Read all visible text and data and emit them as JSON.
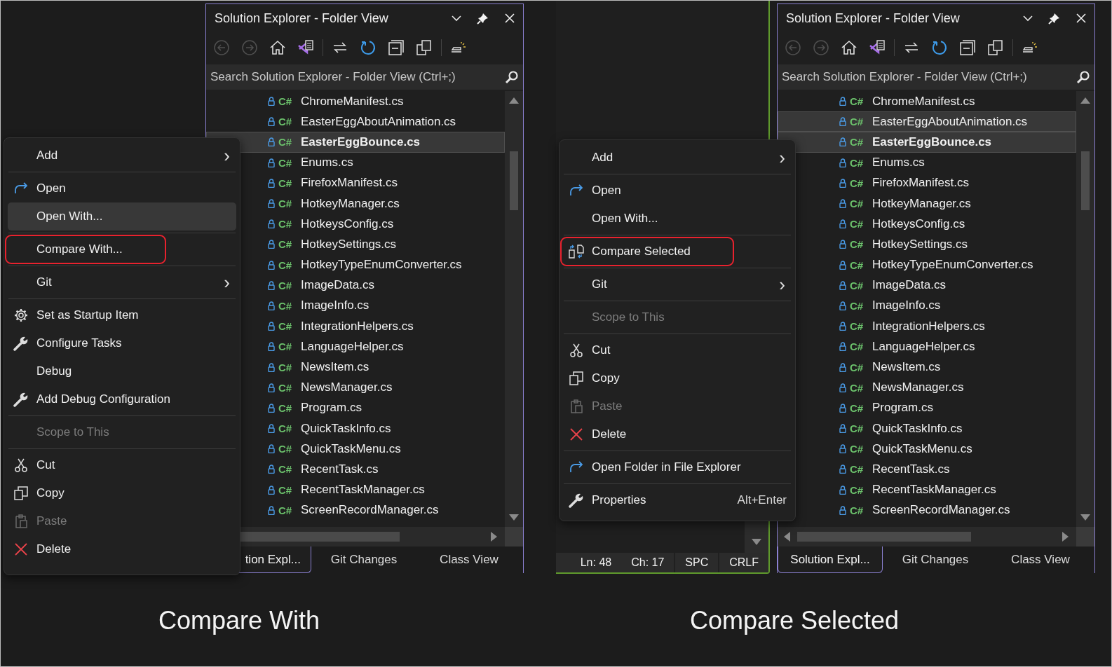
{
  "screens": [
    {
      "caption": "Compare With",
      "solution_explorer": {
        "title": "Solution Explorer - Folder View",
        "search_placeholder": "Search Solution Explorer - Folder View (Ctrl+;)",
        "toolbar": [
          {
            "kind": "back",
            "disabled": true,
            "divider_before": false
          },
          {
            "kind": "forward",
            "disabled": true,
            "divider_before": false
          },
          {
            "kind": "home",
            "disabled": false,
            "divider_before": false
          },
          {
            "kind": "solution",
            "disabled": false,
            "divider_before": false
          },
          {
            "kind": "sync",
            "disabled": false,
            "divider_before": true
          },
          {
            "kind": "refresh",
            "disabled": false,
            "divider_before": false
          },
          {
            "kind": "collapse",
            "disabled": false,
            "divider_before": false
          },
          {
            "kind": "views",
            "disabled": false,
            "divider_before": false
          },
          {
            "kind": "preview",
            "disabled": false,
            "divider_before": true
          }
        ],
        "files": [
          {
            "badge": "C#",
            "name": "ChromeManifest.cs",
            "selected": false,
            "focused": false
          },
          {
            "badge": "C#",
            "name": "EasterEggAboutAnimation.cs",
            "selected": false,
            "focused": false
          },
          {
            "badge": "C#",
            "name": "EasterEggBounce.cs",
            "selected": true,
            "focused": true
          },
          {
            "badge": "C#",
            "name": "Enums.cs",
            "selected": false,
            "focused": false
          },
          {
            "badge": "C#",
            "name": "FirefoxManifest.cs",
            "selected": false,
            "focused": false
          },
          {
            "badge": "C#",
            "name": "HotkeyManager.cs",
            "selected": false,
            "focused": false
          },
          {
            "badge": "C#",
            "name": "HotkeysConfig.cs",
            "selected": false,
            "focused": false
          },
          {
            "badge": "C#",
            "name": "HotkeySettings.cs",
            "selected": false,
            "focused": false
          },
          {
            "badge": "C#",
            "name": "HotkeyTypeEnumConverter.cs",
            "selected": false,
            "focused": false
          },
          {
            "badge": "C#",
            "name": "ImageData.cs",
            "selected": false,
            "focused": false
          },
          {
            "badge": "C#",
            "name": "ImageInfo.cs",
            "selected": false,
            "focused": false
          },
          {
            "badge": "C#",
            "name": "IntegrationHelpers.cs",
            "selected": false,
            "focused": false
          },
          {
            "badge": "C#",
            "name": "LanguageHelper.cs",
            "selected": false,
            "focused": false
          },
          {
            "badge": "C#",
            "name": "NewsItem.cs",
            "selected": false,
            "focused": false
          },
          {
            "badge": "C#",
            "name": "NewsManager.cs",
            "selected": false,
            "focused": false
          },
          {
            "badge": "C#",
            "name": "Program.cs",
            "selected": false,
            "focused": false
          },
          {
            "badge": "C#",
            "name": "QuickTaskInfo.cs",
            "selected": false,
            "focused": false
          },
          {
            "badge": "C#",
            "name": "QuickTaskMenu.cs",
            "selected": false,
            "focused": false
          },
          {
            "badge": "C#",
            "name": "RecentTask.cs",
            "selected": false,
            "focused": false
          },
          {
            "badge": "C#",
            "name": "RecentTaskManager.cs",
            "selected": false,
            "focused": false
          },
          {
            "badge": "C#",
            "name": "ScreenRecordManager.cs",
            "selected": false,
            "focused": false
          }
        ],
        "tabs": [
          {
            "label": "tion Expl...",
            "selected": true
          },
          {
            "label": "Git Changes",
            "selected": false
          },
          {
            "label": "Class View",
            "selected": false
          }
        ]
      },
      "context_menu": {
        "items": [
          {
            "label": "Add",
            "kind": "plain",
            "arrow": "›",
            "disabled": false,
            "hovered": false,
            "outlined": false,
            "divider_before": false
          },
          {
            "label": "Open",
            "kind": "open",
            "disabled": false,
            "hovered": false,
            "outlined": false,
            "divider_before": true
          },
          {
            "label": "Open With...",
            "kind": "plain",
            "disabled": false,
            "hovered": true,
            "outlined": false,
            "divider_before": false
          },
          {
            "label": "Compare With...",
            "kind": "plain",
            "disabled": false,
            "hovered": false,
            "outlined": true,
            "divider_before": true
          },
          {
            "label": "Git",
            "kind": "plain",
            "arrow": "›",
            "disabled": false,
            "hovered": false,
            "outlined": false,
            "divider_before": true
          },
          {
            "label": "Set as Startup Item",
            "kind": "settings",
            "disabled": false,
            "hovered": false,
            "outlined": false,
            "divider_before": true
          },
          {
            "label": "Configure Tasks",
            "kind": "tool",
            "disabled": false,
            "hovered": false,
            "outlined": false,
            "divider_before": false
          },
          {
            "label": "Debug",
            "kind": "plain",
            "disabled": false,
            "hovered": false,
            "outlined": false,
            "divider_before": false
          },
          {
            "label": "Add Debug Configuration",
            "kind": "tool",
            "disabled": false,
            "hovered": false,
            "outlined": false,
            "divider_before": false
          },
          {
            "label": "Scope to This",
            "kind": "plain",
            "disabled": true,
            "hovered": false,
            "outlined": false,
            "divider_before": true
          },
          {
            "label": "Cut",
            "kind": "cut",
            "disabled": false,
            "hovered": false,
            "outlined": false,
            "divider_before": true
          },
          {
            "label": "Copy",
            "kind": "copy",
            "disabled": false,
            "hovered": false,
            "outlined": false,
            "divider_before": false
          },
          {
            "label": "Paste",
            "kind": "paste",
            "disabled": true,
            "hovered": false,
            "outlined": false,
            "divider_before": false
          },
          {
            "label": "Delete",
            "kind": "delete",
            "disabled": false,
            "hovered": false,
            "outlined": false,
            "divider_before": false
          }
        ]
      }
    },
    {
      "caption": "Compare Selected",
      "status_bar": {
        "line": "Ln: 48",
        "column": "Ch: 17",
        "indent": "SPC",
        "line_ending": "CRLF"
      },
      "solution_explorer": {
        "title": "Solution Explorer - Folder View",
        "search_placeholder": "Search Solution Explorer - Folder View (Ctrl+;)",
        "toolbar": [
          {
            "kind": "back",
            "disabled": true,
            "divider_before": false
          },
          {
            "kind": "forward",
            "disabled": true,
            "divider_before": false
          },
          {
            "kind": "home",
            "disabled": false,
            "divider_before": false
          },
          {
            "kind": "solution",
            "disabled": false,
            "divider_before": false
          },
          {
            "kind": "sync",
            "disabled": false,
            "divider_before": true
          },
          {
            "kind": "refresh",
            "disabled": false,
            "divider_before": false
          },
          {
            "kind": "collapse",
            "disabled": false,
            "divider_before": false
          },
          {
            "kind": "views",
            "disabled": false,
            "divider_before": false
          },
          {
            "kind": "preview",
            "disabled": false,
            "divider_before": true
          }
        ],
        "files": [
          {
            "badge": "C#",
            "name": "ChromeManifest.cs",
            "selected": false,
            "focused": false
          },
          {
            "badge": "C#",
            "name": "EasterEggAboutAnimation.cs",
            "selected": true,
            "focused": false
          },
          {
            "badge": "C#",
            "name": "EasterEggBounce.cs",
            "selected": true,
            "focused": true
          },
          {
            "badge": "C#",
            "name": "Enums.cs",
            "selected": false,
            "focused": false
          },
          {
            "badge": "C#",
            "name": "FirefoxManifest.cs",
            "selected": false,
            "focused": false
          },
          {
            "badge": "C#",
            "name": "HotkeyManager.cs",
            "selected": false,
            "focused": false
          },
          {
            "badge": "C#",
            "name": "HotkeysConfig.cs",
            "selected": false,
            "focused": false
          },
          {
            "badge": "C#",
            "name": "HotkeySettings.cs",
            "selected": false,
            "focused": false
          },
          {
            "badge": "C#",
            "name": "HotkeyTypeEnumConverter.cs",
            "selected": false,
            "focused": false
          },
          {
            "badge": "C#",
            "name": "ImageData.cs",
            "selected": false,
            "focused": false
          },
          {
            "badge": "C#",
            "name": "ImageInfo.cs",
            "selected": false,
            "focused": false
          },
          {
            "badge": "C#",
            "name": "IntegrationHelpers.cs",
            "selected": false,
            "focused": false
          },
          {
            "badge": "C#",
            "name": "LanguageHelper.cs",
            "selected": false,
            "focused": false
          },
          {
            "badge": "C#",
            "name": "NewsItem.cs",
            "selected": false,
            "focused": false
          },
          {
            "badge": "C#",
            "name": "NewsManager.cs",
            "selected": false,
            "focused": false
          },
          {
            "badge": "C#",
            "name": "Program.cs",
            "selected": false,
            "focused": false
          },
          {
            "badge": "C#",
            "name": "QuickTaskInfo.cs",
            "selected": false,
            "focused": false
          },
          {
            "badge": "C#",
            "name": "QuickTaskMenu.cs",
            "selected": false,
            "focused": false
          },
          {
            "badge": "C#",
            "name": "RecentTask.cs",
            "selected": false,
            "focused": false
          },
          {
            "badge": "C#",
            "name": "RecentTaskManager.cs",
            "selected": false,
            "focused": false
          },
          {
            "badge": "C#",
            "name": "ScreenRecordManager.cs",
            "selected": false,
            "focused": false
          }
        ],
        "tabs": [
          {
            "label": "Solution Expl...",
            "selected": true
          },
          {
            "label": "Git Changes",
            "selected": false
          },
          {
            "label": "Class View",
            "selected": false
          }
        ]
      },
      "context_menu": {
        "items": [
          {
            "label": "Add",
            "kind": "plain",
            "arrow": "›",
            "disabled": false,
            "hovered": false,
            "outlined": false,
            "divider_before": false
          },
          {
            "label": "Open",
            "kind": "open",
            "disabled": false,
            "hovered": false,
            "outlined": false,
            "divider_before": true
          },
          {
            "label": "Open With...",
            "kind": "plain",
            "disabled": false,
            "hovered": false,
            "outlined": false,
            "divider_before": false
          },
          {
            "label": "Compare Selected",
            "kind": "compare",
            "disabled": false,
            "hovered": false,
            "outlined": true,
            "divider_before": true
          },
          {
            "label": "Git",
            "kind": "plain",
            "arrow": "›",
            "disabled": false,
            "hovered": false,
            "outlined": false,
            "divider_before": true
          },
          {
            "label": "Scope to This",
            "kind": "plain",
            "disabled": true,
            "hovered": false,
            "outlined": false,
            "divider_before": true
          },
          {
            "label": "Cut",
            "kind": "cut",
            "disabled": false,
            "hovered": false,
            "outlined": false,
            "divider_before": true
          },
          {
            "label": "Copy",
            "kind": "copy",
            "disabled": false,
            "hovered": false,
            "outlined": false,
            "divider_before": false
          },
          {
            "label": "Paste",
            "kind": "paste",
            "disabled": true,
            "hovered": false,
            "outlined": false,
            "divider_before": false
          },
          {
            "label": "Delete",
            "kind": "delete",
            "disabled": false,
            "hovered": false,
            "outlined": false,
            "divider_before": false
          },
          {
            "label": "Open Folder in File Explorer",
            "kind": "open",
            "disabled": false,
            "hovered": false,
            "outlined": false,
            "divider_before": true
          },
          {
            "label": "Properties",
            "kind": "tool",
            "disabled": false,
            "hovered": false,
            "outlined": false,
            "divider_before": true,
            "shortcut": "Alt+Enter"
          }
        ]
      }
    }
  ]
}
